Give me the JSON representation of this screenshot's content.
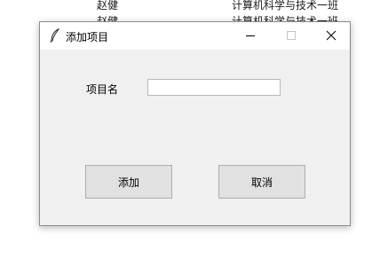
{
  "background_rows": [
    {
      "name": "赵健",
      "class": "计算机科学与技术一班"
    },
    {
      "name": "赵健",
      "class": "计算机科学与技术一班"
    }
  ],
  "dialog": {
    "title": "添加项目",
    "icon": "feather-icon",
    "controls": {
      "minimize": "minimize-icon",
      "maximize": "maximize-icon",
      "close": "close-icon"
    },
    "form": {
      "name_label": "项目名",
      "name_value": "",
      "name_placeholder": ""
    },
    "buttons": {
      "add_label": "添加",
      "cancel_label": "取消"
    }
  }
}
